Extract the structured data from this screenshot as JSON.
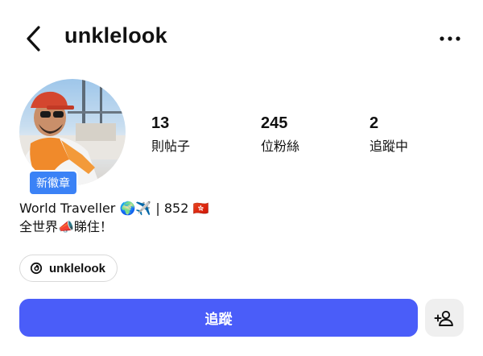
{
  "header": {
    "username": "unklelook",
    "back_icon": "chevron-left-icon",
    "more_icon": "more-horizontal-icon"
  },
  "profile": {
    "badge": "新徽章",
    "stats": [
      {
        "value": "13",
        "label": "則帖子"
      },
      {
        "value": "245",
        "label": "位粉絲"
      },
      {
        "value": "2",
        "label": "追蹤中"
      }
    ],
    "bio_line1": "World Traveller 🌍✈️ | 852 🇭🇰",
    "bio_line2": "全世界📣睇住！"
  },
  "threads_link": {
    "icon": "threads-icon",
    "label": "unklelook"
  },
  "actions": {
    "follow_label": "追蹤",
    "follow_color": "#4a5df9",
    "add_user_icon": "add-user-icon"
  }
}
